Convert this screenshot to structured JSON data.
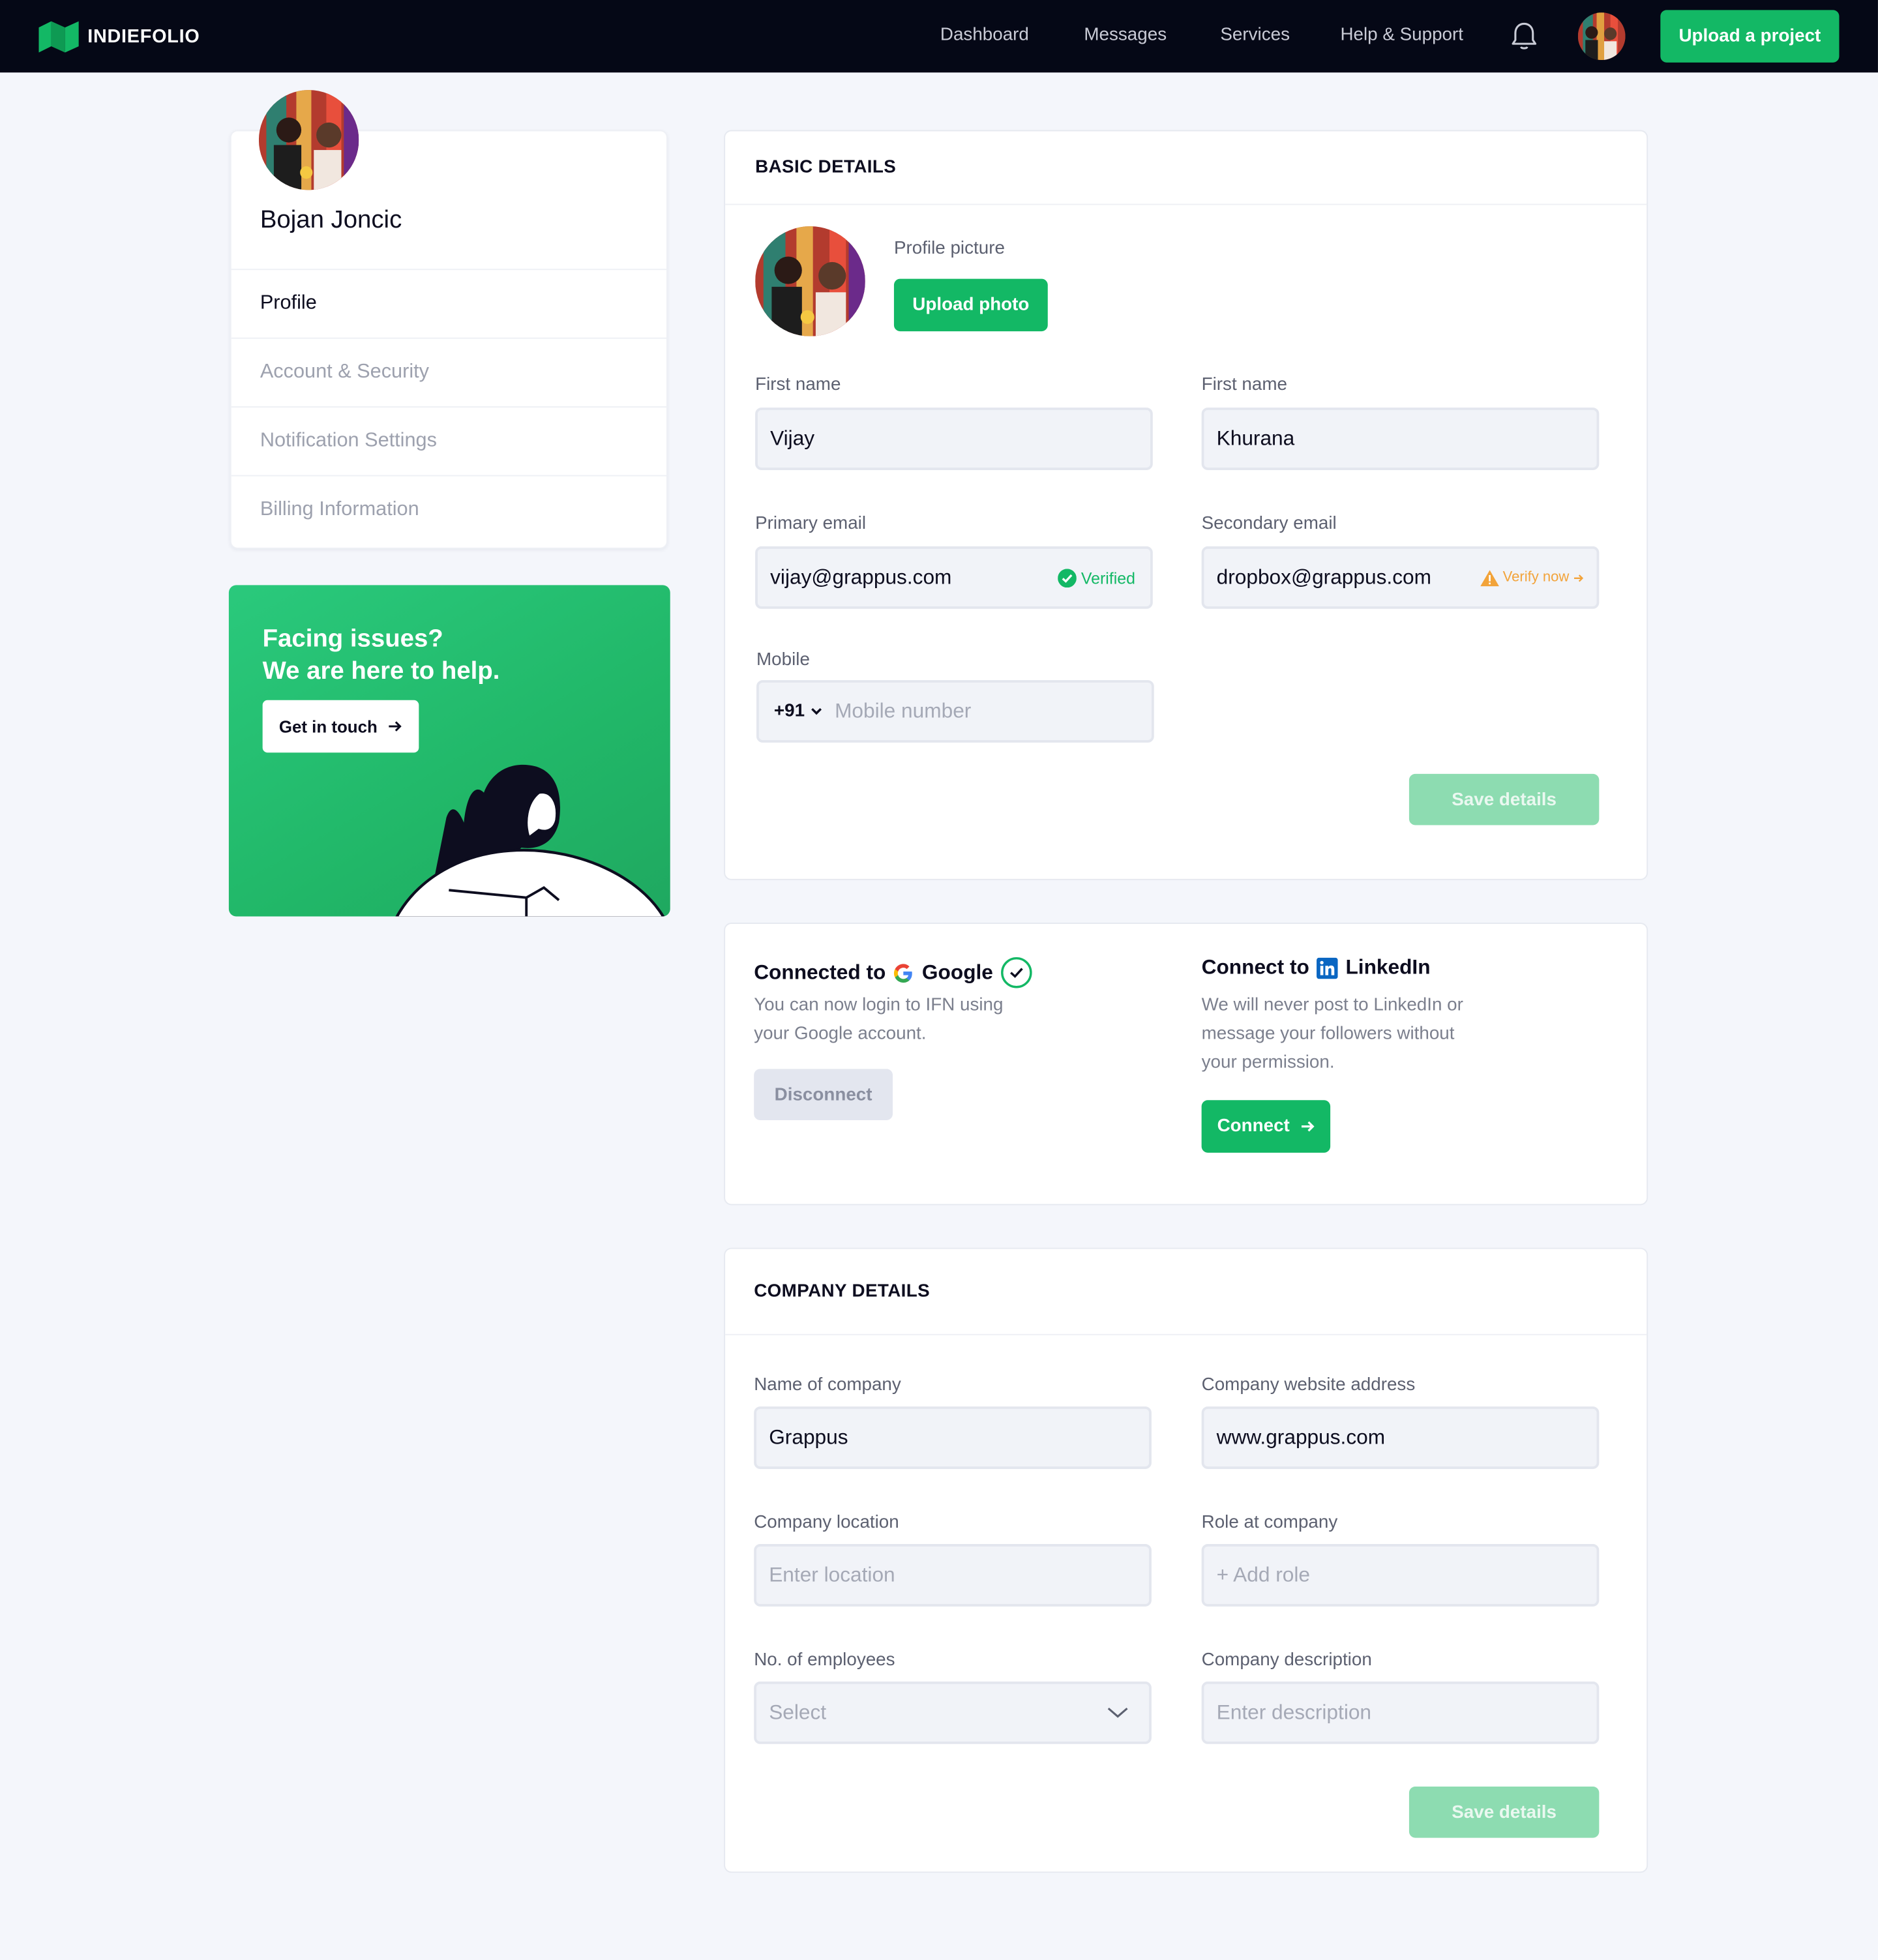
{
  "brand": {
    "name": "INDIEFOLIO"
  },
  "nav": {
    "items": [
      {
        "label": "Dashboard"
      },
      {
        "label": "Messages"
      },
      {
        "label": "Services"
      },
      {
        "label": "Help & Support"
      }
    ],
    "upload_label": "Upload a project",
    "icons": [
      "bell-icon",
      "avatar"
    ]
  },
  "sidebar": {
    "name": "Bojan Joncic",
    "items": [
      {
        "label": "Profile",
        "active": true
      },
      {
        "label": "Account & Security"
      },
      {
        "label": "Notification Settings"
      },
      {
        "label": "Billing Information"
      }
    ]
  },
  "help": {
    "title_line1": "Facing issues?",
    "title_line2": "We are here to help.",
    "button_label": "Get in touch"
  },
  "basic": {
    "heading": "BASIC DETAILS",
    "profile_picture_label": "Profile picture",
    "upload_photo_label": "Upload photo",
    "first_name_label": "First name",
    "first_name_value": "Vijay",
    "last_name_label": "First name",
    "last_name_value": "Khurana",
    "primary_email_label": "Primary email",
    "primary_email_value": "vijay@grappus.com",
    "verified_label": "Verified",
    "secondary_email_label": "Secondary email",
    "secondary_email_value": "dropbox@grappus.com",
    "verify_now_label": "Verify now",
    "mobile_label": "Mobile",
    "country_code": "+91",
    "mobile_placeholder": "Mobile number",
    "save_label": "Save details"
  },
  "connections": {
    "google": {
      "prefix": "Connected to",
      "name": "Google",
      "text_line1": "You can now login to IFN using",
      "text_line2": "your Google account.",
      "button_label": "Disconnect"
    },
    "linkedin": {
      "prefix": "Connect to",
      "name": "LinkedIn",
      "text_line1": "We will never post to LinkedIn or",
      "text_line2": "message your followers without",
      "text_line3": "your permission.",
      "button_label": "Connect"
    }
  },
  "company": {
    "heading": "COMPANY DETAILS",
    "name_label": "Name of company",
    "name_value": "Grappus",
    "website_label": "Company website address",
    "website_value": "www.grappus.com",
    "location_label": "Company location",
    "location_placeholder": "Enter location",
    "role_label": "Role at company",
    "role_placeholder": "+ Add role",
    "employees_label": "No. of employees",
    "employees_placeholder": "Select",
    "description_label": "Company description",
    "description_placeholder": "Enter description",
    "save_label": "Save details"
  },
  "colors": {
    "topbar": "#050816",
    "accent": "#13b865",
    "accent_light": "#8ddcb1",
    "warning": "#f2a33a",
    "page_bg": "#f4f6fb"
  }
}
